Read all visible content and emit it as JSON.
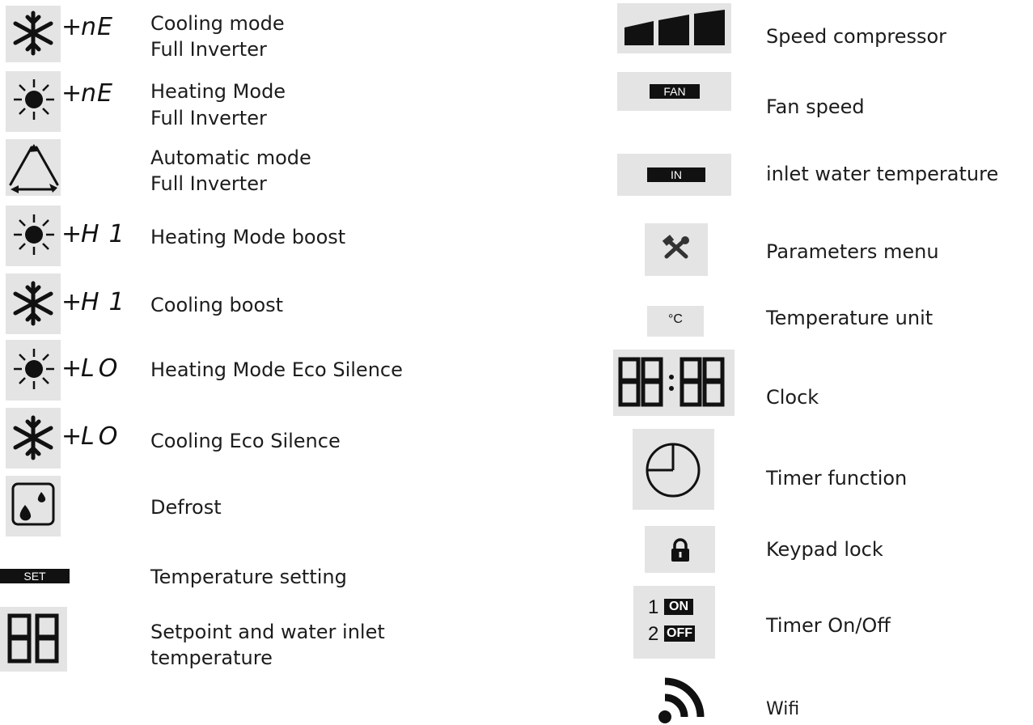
{
  "left": [
    {
      "line1": "Cooling mode",
      "line2": "Full Inverter",
      "code": "nE",
      "icon": "snowflake-icon"
    },
    {
      "line1": "Heating Mode",
      "line2": "Full Inverter",
      "code": "nE",
      "icon": "sun-icon"
    },
    {
      "line1": "Automatic mode",
      "line2": "Full Inverter",
      "icon": "triangle-cycle-icon"
    },
    {
      "line1": "Heating Mode boost",
      "code": "H1",
      "icon": "sun-icon"
    },
    {
      "line1": "Cooling boost",
      "code": "H1",
      "icon": "snowflake-icon"
    },
    {
      "line1": "Heating Mode Eco Silence",
      "code": "LO",
      "icon": "sun-icon"
    },
    {
      "line1": "Cooling Eco Silence",
      "code": "LO",
      "icon": "snowflake-icon"
    },
    {
      "line1": "Defrost",
      "icon": "defrost-drops-icon"
    },
    {
      "line1": "Temperature setting",
      "tag": "SET"
    },
    {
      "line1": "Setpoint and water inlet",
      "line2": "temperature",
      "icon": "seven-segment-88-icon"
    }
  ],
  "right": [
    {
      "line1": "Speed compressor",
      "icon": "speed-bars-icon"
    },
    {
      "line1": "Fan speed",
      "tag": "FAN"
    },
    {
      "line1": "inlet water temperature",
      "tag": "IN"
    },
    {
      "line1": "Parameters menu",
      "icon": "tools-icon"
    },
    {
      "line1": "Temperature unit",
      "unit": "°C"
    },
    {
      "line1": "Clock",
      "icon": "seven-segment-clock-icon"
    },
    {
      "line1": "Timer function",
      "icon": "clock-circle-icon"
    },
    {
      "line1": "Keypad lock",
      "icon": "lock-icon"
    },
    {
      "line1": "Timer On/Off",
      "timer": {
        "n1": "1",
        "on": "ON",
        "n2": "2",
        "off": "OFF"
      }
    },
    {
      "line1": "Wifi",
      "icon": "wifi-icon"
    }
  ],
  "plus": "+",
  "colors": {
    "tile": "#e4e4e4",
    "ink": "#111111"
  }
}
